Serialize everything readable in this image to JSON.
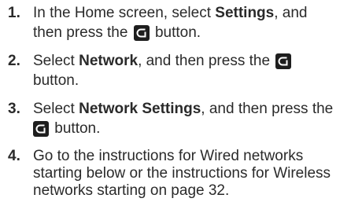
{
  "steps": [
    {
      "number": "1.",
      "line1_pre": "In the Home screen, select ",
      "line1_bold": "Settings",
      "line1_post": ", and",
      "line2_pre": "then press the ",
      "line2_post": " button."
    },
    {
      "number": "2.",
      "line1_pre": "Select ",
      "line1_bold": "Network",
      "line1_post": ", and then press the ",
      "line2_text": "button."
    },
    {
      "number": "3.",
      "line1_pre": "Select ",
      "line1_bold": "Network Settings",
      "line1_post": ", and then press the",
      "line2_post": " button."
    },
    {
      "number": "4.",
      "lines": [
        "Go to the instructions for Wired networks",
        "starting below or the instructions for Wireless",
        "networks starting on page 32."
      ]
    }
  ],
  "icons": {
    "enter": "enter-button-icon"
  },
  "colors": {
    "text": "#2a2a2a",
    "icon_bg": "#1e1e1e"
  }
}
